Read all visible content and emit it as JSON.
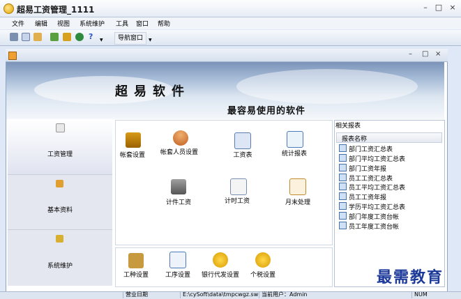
{
  "window": {
    "title": "超易工资管理_1111"
  },
  "menu": [
    "文件",
    "编辑",
    "视图",
    "系统维护",
    "工具",
    "窗口",
    "帮助"
  ],
  "toolbar": {
    "nav_label": "导航窗口"
  },
  "banner": {
    "title": "超易软件",
    "slogan": "最容易使用的软件"
  },
  "sidebar": [
    {
      "label": "工资管理"
    },
    {
      "label": "基本资料"
    },
    {
      "label": "系统维护"
    }
  ],
  "main_icons": [
    {
      "label": "帐套设置"
    },
    {
      "label": "帐套人员设置"
    },
    {
      "label": "工资表"
    },
    {
      "label": "统计报表"
    },
    {
      "label": "计件工资"
    },
    {
      "label": "计时工资"
    },
    {
      "label": "月末处理"
    }
  ],
  "bottom_icons": [
    {
      "label": "工种设置"
    },
    {
      "label": "工序设置"
    },
    {
      "label": "银行代发设置"
    },
    {
      "label": "个税设置"
    }
  ],
  "reports": {
    "title": "相关报表",
    "column": "报表名称",
    "items": [
      "部门工资汇总表",
      "部门平均工资汇总表",
      "部门工资年报",
      "员工工资汇总表",
      "员工平均工资汇总表",
      "员工工资年报",
      "学历平均工资汇总表",
      "部门年度工资台帐",
      "员工年度工资台帐"
    ]
  },
  "status": {
    "date": "营业日期",
    "path": "E:\\cySoft\\data\\tmpcwgz.sw",
    "user": "当前用户：Admin",
    "num": "NUM"
  },
  "watermark": "最需教育"
}
